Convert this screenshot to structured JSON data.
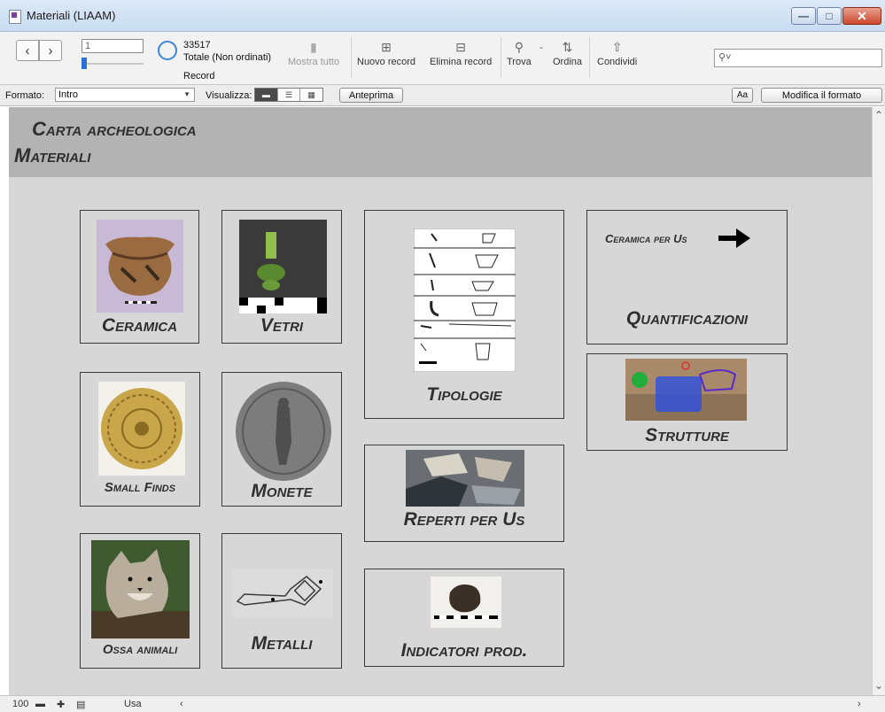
{
  "window": {
    "title": "Materiali (LIAAM)"
  },
  "toolbar": {
    "record_input": "1",
    "found_count": "33517",
    "total_label": "Totale (Non ordinati)",
    "record_label": "Record",
    "tools": {
      "show_all": "Mostra tutto",
      "new_record": "Nuovo record",
      "delete_record": "Elimina record",
      "find": "Trova",
      "sort": "Ordina",
      "share": "Condividi"
    }
  },
  "layout_bar": {
    "format_label": "Formato:",
    "format_value": "Intro",
    "view_label": "Visualizza:",
    "preview_button": "Anteprima",
    "font_button": "Aa",
    "edit_layout_button": "Modifica il formato"
  },
  "header": {
    "line1": "Carta archeologica",
    "line2": "Materiali"
  },
  "cards": {
    "ceramica": "Ceramica",
    "vetri": "Vetri",
    "tipologie": "Tipologie",
    "quantificazioni_link": "Ceramica per Us",
    "quantificazioni": "Quantificazioni",
    "strutture": "Strutture",
    "small_finds": "Small Finds",
    "monete": "Monete",
    "reperti": "Reperti per Us",
    "ossa": "Ossa animali",
    "metalli": "Metalli",
    "indicatori": "Indicatori prod."
  },
  "statusbar": {
    "zoom": "100",
    "mode": "Usa"
  },
  "icons": {
    "prev": "chevron-left-icon",
    "next": "chevron-right-icon",
    "search": "search-icon",
    "arrow": "arrow-right-icon"
  }
}
